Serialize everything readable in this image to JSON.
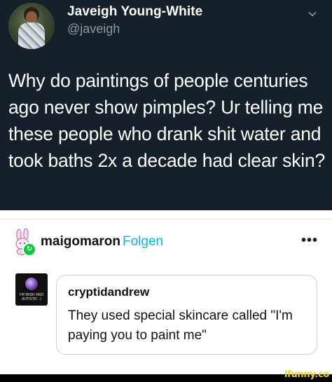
{
  "tweet": {
    "display_name": "Javeigh Young-White",
    "handle": "@javeigh",
    "text": "Why do paintings of people centuries ago never show pimples? Ur telling me these people who drank shit water and took baths 2x a decade had clear skin?",
    "menu_icon": "chevron-down-icon"
  },
  "post": {
    "username": "maigomaron",
    "follow_label": "Folgen",
    "more_label": "•••",
    "avatar_icon": "bunny-icon",
    "badge_icon": "reblog-icon"
  },
  "reply": {
    "username": "cryptidandrew",
    "text": "They used special skincare called \"I'm paying you to paint me\"",
    "avatar_caption": "I'M IRISH AND AUTISTIC :)"
  },
  "watermark": {
    "text": "ifunny.co"
  },
  "colors": {
    "tweet_bg": "#15202b",
    "handle": "#8899a6",
    "follow": "#00b8ff",
    "badge": "#00cf35",
    "watermark": "#f4d400"
  }
}
